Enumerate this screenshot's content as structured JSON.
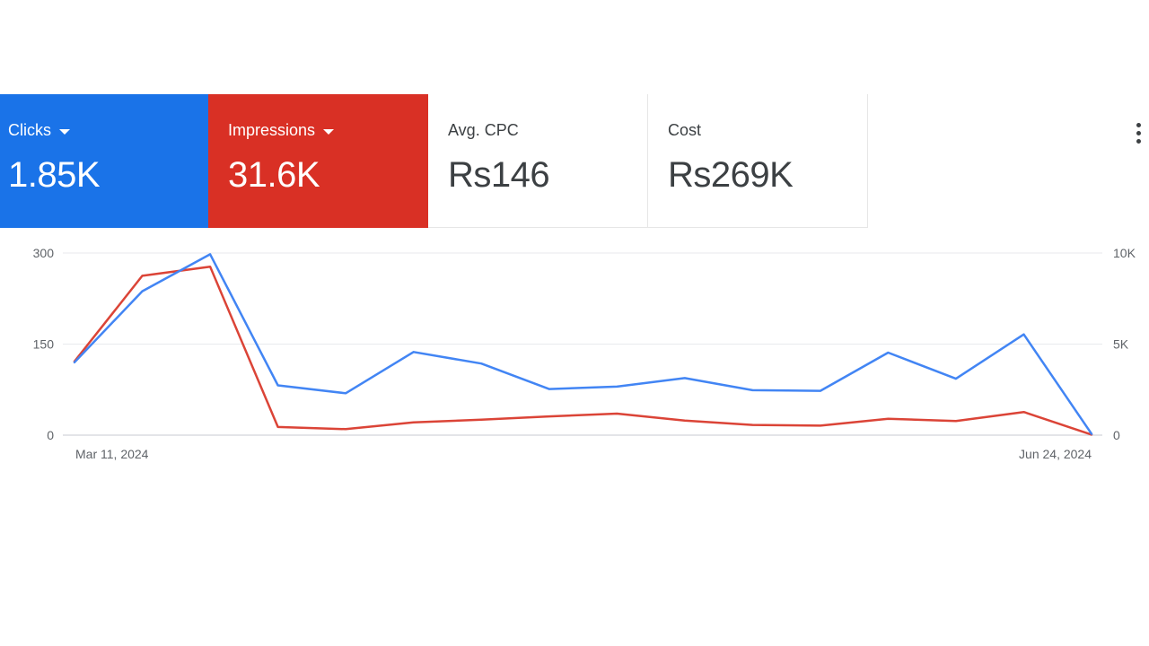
{
  "scorecards": [
    {
      "label": "Clicks",
      "value": "1.85K",
      "selected": true,
      "color": "#1a73e8",
      "dropdown": true
    },
    {
      "label": "Impressions",
      "value": "31.6K",
      "selected": true,
      "color": "#d93025",
      "dropdown": true
    },
    {
      "label": "Avg. CPC",
      "value": "Rs146",
      "selected": false
    },
    {
      "label": "Cost",
      "value": "Rs269K",
      "selected": false
    }
  ],
  "more_icon": "more-vert-icon",
  "chart_data": {
    "type": "line",
    "x_start_label": "Mar 11, 2024",
    "x_end_label": "Jun 24, 2024",
    "left_axis": {
      "ticks": [
        "0",
        "150",
        "300"
      ],
      "range": [
        0,
        300
      ]
    },
    "right_axis": {
      "ticks": [
        "0",
        "5K",
        "10K"
      ],
      "range": [
        0,
        10000
      ]
    },
    "grid": true,
    "series": [
      {
        "name": "Clicks",
        "axis": "left",
        "color": "#4285f4",
        "values": [
          120,
          237,
          298,
          82,
          69,
          137,
          118,
          76,
          80,
          94,
          74,
          73,
          136,
          93,
          166,
          2
        ]
      },
      {
        "name": "Impressions",
        "axis": "right",
        "color": "#db4437",
        "values": [
          4050,
          8750,
          9250,
          450,
          330,
          700,
          850,
          1030,
          1180,
          800,
          560,
          520,
          900,
          780,
          1270,
          30
        ]
      }
    ]
  }
}
